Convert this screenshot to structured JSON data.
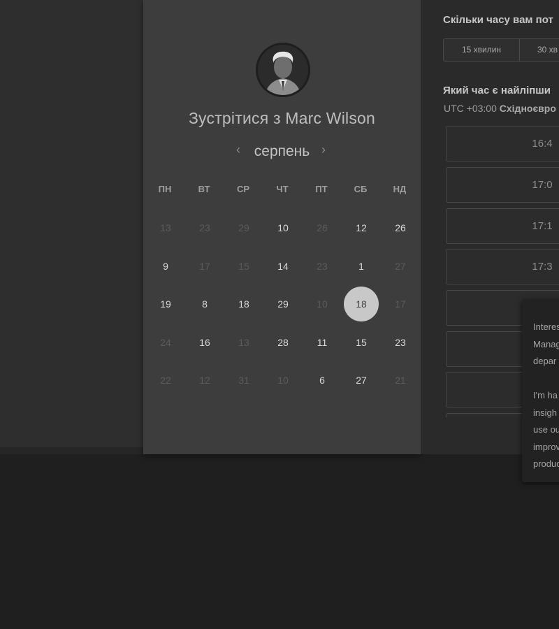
{
  "host": {
    "title": "Зустрітися з Marc Wilson",
    "avatar_icon": "person-photo-icon"
  },
  "calendar": {
    "month": "серпень",
    "prev_icon": "chevron-left-icon",
    "next_icon": "chevron-right-icon",
    "weekdays": [
      "ПН",
      "ВТ",
      "СР",
      "ЧТ",
      "ПТ",
      "СБ",
      "НД"
    ],
    "weeks": [
      [
        {
          "d": "13",
          "a": false
        },
        {
          "d": "23",
          "a": false
        },
        {
          "d": "29",
          "a": false
        },
        {
          "d": "10",
          "a": true
        },
        {
          "d": "26",
          "a": false
        },
        {
          "d": "12",
          "a": true
        },
        {
          "d": "26",
          "a": true
        }
      ],
      [
        {
          "d": "9",
          "a": true
        },
        {
          "d": "17",
          "a": false
        },
        {
          "d": "15",
          "a": false
        },
        {
          "d": "14",
          "a": true
        },
        {
          "d": "23",
          "a": false
        },
        {
          "d": "1",
          "a": true
        },
        {
          "d": "27",
          "a": false
        }
      ],
      [
        {
          "d": "19",
          "a": true
        },
        {
          "d": "8",
          "a": true
        },
        {
          "d": "18",
          "a": true
        },
        {
          "d": "29",
          "a": true
        },
        {
          "d": "10",
          "a": false
        },
        {
          "d": "18",
          "a": true,
          "selected": true
        },
        {
          "d": "17",
          "a": false
        }
      ],
      [
        {
          "d": "24",
          "a": false
        },
        {
          "d": "16",
          "a": true
        },
        {
          "d": "13",
          "a": false
        },
        {
          "d": "28",
          "a": true
        },
        {
          "d": "11",
          "a": true
        },
        {
          "d": "15",
          "a": true
        },
        {
          "d": "23",
          "a": true
        }
      ],
      [
        {
          "d": "22",
          "a": false
        },
        {
          "d": "12",
          "a": false
        },
        {
          "d": "31",
          "a": false
        },
        {
          "d": "10",
          "a": false
        },
        {
          "d": "6",
          "a": true
        },
        {
          "d": "27",
          "a": true
        },
        {
          "d": "21",
          "a": false
        }
      ]
    ]
  },
  "booking": {
    "duration_question": "Скільки часу вам пот",
    "durations": [
      "15 хвилин",
      "30 хв"
    ],
    "time_question": "Який час є найліпши",
    "timezone_offset": "UTC +03:00",
    "timezone_name": "Східноєвро",
    "slots": [
      "16:4",
      "17:0",
      "17:1",
      "17:3",
      "",
      "",
      "",
      ""
    ]
  },
  "tooltip": {
    "lines_1": [
      "Interes",
      "Manag",
      "depar"
    ],
    "lines_2": [
      "I'm ha",
      "insigh",
      "use ou",
      "improv",
      "produc"
    ]
  }
}
